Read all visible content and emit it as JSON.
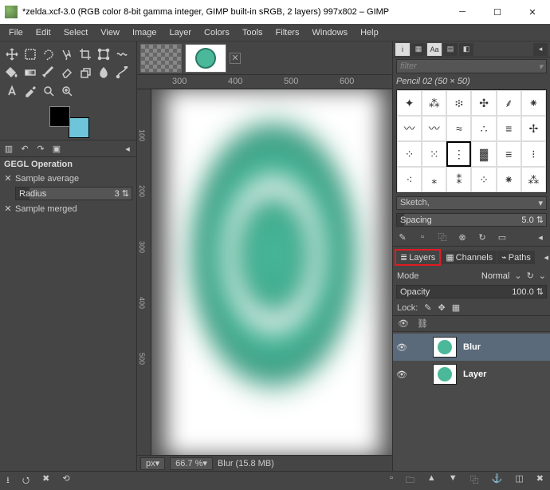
{
  "window": {
    "title": "*zelda.xcf-3.0 (RGB color 8-bit gamma integer, GIMP built-in sRGB, 2 layers) 997x802 – GIMP"
  },
  "menu": [
    "File",
    "Edit",
    "Select",
    "View",
    "Image",
    "Layer",
    "Colors",
    "Tools",
    "Filters",
    "Windows",
    "Help"
  ],
  "tool_options": {
    "title": "GEGL Operation",
    "sample_avg": "Sample average",
    "radius_label": "Radius",
    "radius_value": "3",
    "sample_merged": "Sample merged"
  },
  "ruler_h": {
    "t1": "300",
    "t2": "400",
    "t3": "500",
    "t4": "600"
  },
  "ruler_v": {
    "t1": "100",
    "t2": "200",
    "t3": "300",
    "t4": "400",
    "t5": "500"
  },
  "status": {
    "unit": "px",
    "zoom": "66.7 %",
    "info": "Blur (15.8 MB)"
  },
  "right": {
    "filter_placeholder": "filter",
    "brush_name": "Pencil 02 (50 × 50)",
    "tag_label": "Sketch,",
    "spacing_label": "Spacing",
    "spacing_value": "5.0",
    "tabs": {
      "layers": "Layers",
      "channels": "Channels",
      "paths": "Paths"
    },
    "mode_label": "Mode",
    "mode_value": "Normal",
    "opacity_label": "Opacity",
    "opacity_value": "100.0",
    "lock_label": "Lock:",
    "layers": [
      {
        "name": "Blur"
      },
      {
        "name": "Layer"
      }
    ]
  }
}
